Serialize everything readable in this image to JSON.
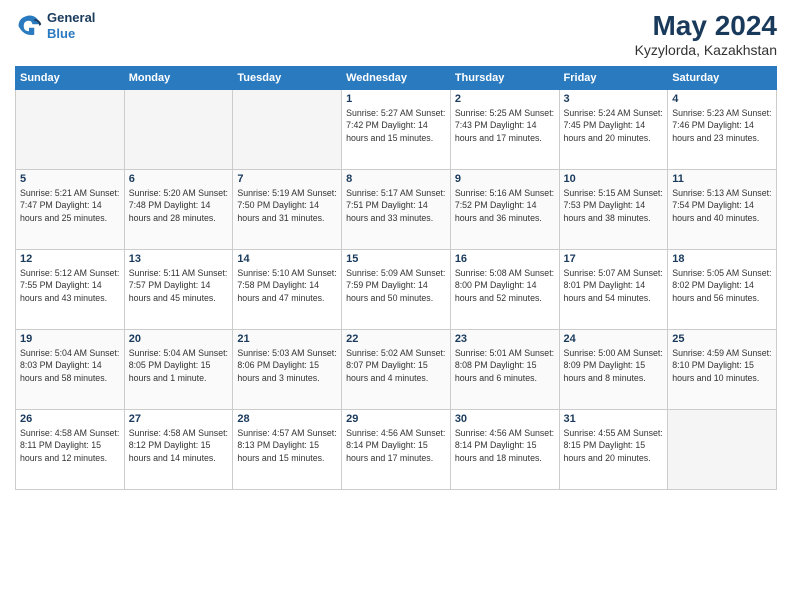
{
  "logo": {
    "line1": "General",
    "line2": "Blue"
  },
  "title": "May 2024",
  "location": "Kyzylorda, Kazakhstan",
  "days_header": [
    "Sunday",
    "Monday",
    "Tuesday",
    "Wednesday",
    "Thursday",
    "Friday",
    "Saturday"
  ],
  "weeks": [
    [
      {
        "day": "",
        "info": ""
      },
      {
        "day": "",
        "info": ""
      },
      {
        "day": "",
        "info": ""
      },
      {
        "day": "1",
        "info": "Sunrise: 5:27 AM\nSunset: 7:42 PM\nDaylight: 14 hours\nand 15 minutes."
      },
      {
        "day": "2",
        "info": "Sunrise: 5:25 AM\nSunset: 7:43 PM\nDaylight: 14 hours\nand 17 minutes."
      },
      {
        "day": "3",
        "info": "Sunrise: 5:24 AM\nSunset: 7:45 PM\nDaylight: 14 hours\nand 20 minutes."
      },
      {
        "day": "4",
        "info": "Sunrise: 5:23 AM\nSunset: 7:46 PM\nDaylight: 14 hours\nand 23 minutes."
      }
    ],
    [
      {
        "day": "5",
        "info": "Sunrise: 5:21 AM\nSunset: 7:47 PM\nDaylight: 14 hours\nand 25 minutes."
      },
      {
        "day": "6",
        "info": "Sunrise: 5:20 AM\nSunset: 7:48 PM\nDaylight: 14 hours\nand 28 minutes."
      },
      {
        "day": "7",
        "info": "Sunrise: 5:19 AM\nSunset: 7:50 PM\nDaylight: 14 hours\nand 31 minutes."
      },
      {
        "day": "8",
        "info": "Sunrise: 5:17 AM\nSunset: 7:51 PM\nDaylight: 14 hours\nand 33 minutes."
      },
      {
        "day": "9",
        "info": "Sunrise: 5:16 AM\nSunset: 7:52 PM\nDaylight: 14 hours\nand 36 minutes."
      },
      {
        "day": "10",
        "info": "Sunrise: 5:15 AM\nSunset: 7:53 PM\nDaylight: 14 hours\nand 38 minutes."
      },
      {
        "day": "11",
        "info": "Sunrise: 5:13 AM\nSunset: 7:54 PM\nDaylight: 14 hours\nand 40 minutes."
      }
    ],
    [
      {
        "day": "12",
        "info": "Sunrise: 5:12 AM\nSunset: 7:55 PM\nDaylight: 14 hours\nand 43 minutes."
      },
      {
        "day": "13",
        "info": "Sunrise: 5:11 AM\nSunset: 7:57 PM\nDaylight: 14 hours\nand 45 minutes."
      },
      {
        "day": "14",
        "info": "Sunrise: 5:10 AM\nSunset: 7:58 PM\nDaylight: 14 hours\nand 47 minutes."
      },
      {
        "day": "15",
        "info": "Sunrise: 5:09 AM\nSunset: 7:59 PM\nDaylight: 14 hours\nand 50 minutes."
      },
      {
        "day": "16",
        "info": "Sunrise: 5:08 AM\nSunset: 8:00 PM\nDaylight: 14 hours\nand 52 minutes."
      },
      {
        "day": "17",
        "info": "Sunrise: 5:07 AM\nSunset: 8:01 PM\nDaylight: 14 hours\nand 54 minutes."
      },
      {
        "day": "18",
        "info": "Sunrise: 5:05 AM\nSunset: 8:02 PM\nDaylight: 14 hours\nand 56 minutes."
      }
    ],
    [
      {
        "day": "19",
        "info": "Sunrise: 5:04 AM\nSunset: 8:03 PM\nDaylight: 14 hours\nand 58 minutes."
      },
      {
        "day": "20",
        "info": "Sunrise: 5:04 AM\nSunset: 8:05 PM\nDaylight: 15 hours\nand 1 minute."
      },
      {
        "day": "21",
        "info": "Sunrise: 5:03 AM\nSunset: 8:06 PM\nDaylight: 15 hours\nand 3 minutes."
      },
      {
        "day": "22",
        "info": "Sunrise: 5:02 AM\nSunset: 8:07 PM\nDaylight: 15 hours\nand 4 minutes."
      },
      {
        "day": "23",
        "info": "Sunrise: 5:01 AM\nSunset: 8:08 PM\nDaylight: 15 hours\nand 6 minutes."
      },
      {
        "day": "24",
        "info": "Sunrise: 5:00 AM\nSunset: 8:09 PM\nDaylight: 15 hours\nand 8 minutes."
      },
      {
        "day": "25",
        "info": "Sunrise: 4:59 AM\nSunset: 8:10 PM\nDaylight: 15 hours\nand 10 minutes."
      }
    ],
    [
      {
        "day": "26",
        "info": "Sunrise: 4:58 AM\nSunset: 8:11 PM\nDaylight: 15 hours\nand 12 minutes."
      },
      {
        "day": "27",
        "info": "Sunrise: 4:58 AM\nSunset: 8:12 PM\nDaylight: 15 hours\nand 14 minutes."
      },
      {
        "day": "28",
        "info": "Sunrise: 4:57 AM\nSunset: 8:13 PM\nDaylight: 15 hours\nand 15 minutes."
      },
      {
        "day": "29",
        "info": "Sunrise: 4:56 AM\nSunset: 8:14 PM\nDaylight: 15 hours\nand 17 minutes."
      },
      {
        "day": "30",
        "info": "Sunrise: 4:56 AM\nSunset: 8:14 PM\nDaylight: 15 hours\nand 18 minutes."
      },
      {
        "day": "31",
        "info": "Sunrise: 4:55 AM\nSunset: 8:15 PM\nDaylight: 15 hours\nand 20 minutes."
      },
      {
        "day": "",
        "info": ""
      }
    ]
  ]
}
